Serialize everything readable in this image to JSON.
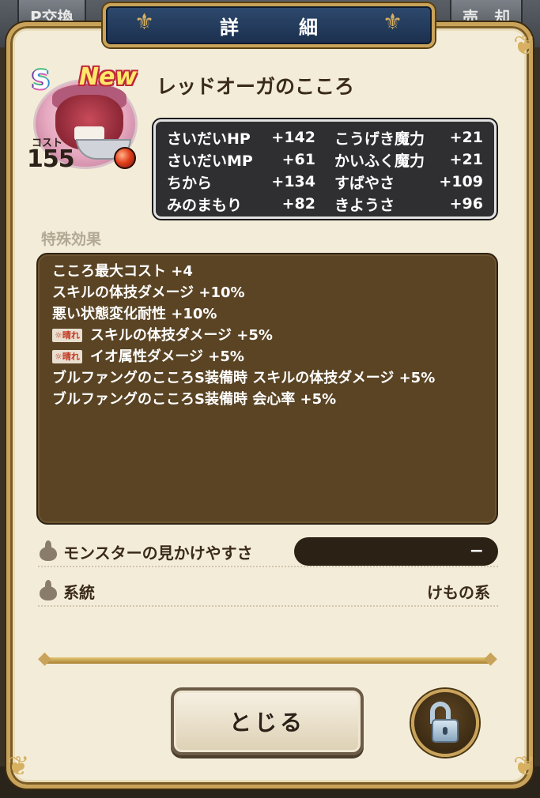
{
  "background": {
    "left_tab": "P交換",
    "right_tab": "売　却"
  },
  "dialog": {
    "title": "詳　細"
  },
  "monster": {
    "rank": "S",
    "new_badge": "New",
    "cost_label": "コスト",
    "cost_value": "155",
    "name": "レッドオーガのこころ"
  },
  "stats": [
    {
      "label": "さいだいHP",
      "value": "+142"
    },
    {
      "label": "こうげき魔力",
      "value": "+21"
    },
    {
      "label": "さいだいMP",
      "value": "+61"
    },
    {
      "label": "かいふく魔力",
      "value": "+21"
    },
    {
      "label": "ちから",
      "value": "+134"
    },
    {
      "label": "すばやさ",
      "value": "+109"
    },
    {
      "label": "みのまもり",
      "value": "+82"
    },
    {
      "label": "きようさ",
      "value": "+96"
    }
  ],
  "special": {
    "label": "特殊効果",
    "effects": [
      {
        "tag": "",
        "text": "こころ最大コスト +4"
      },
      {
        "tag": "",
        "text": "スキルの体技ダメージ +10%"
      },
      {
        "tag": "",
        "text": "悪い状態変化耐性 +10%"
      },
      {
        "tag": "☼晴れ",
        "text": "スキルの体技ダメージ +5%"
      },
      {
        "tag": "☼晴れ",
        "text": "イオ属性ダメージ +5%"
      },
      {
        "tag": "",
        "text": "ブルファングのこころS装備時 スキルの体技ダメージ +5%"
      },
      {
        "tag": "",
        "text": "ブルファングのこころS装備時 会心率 +5%"
      }
    ]
  },
  "info": {
    "visibility_label": "モンスターの見かけやすさ",
    "visibility_value": "−",
    "type_label": "系統",
    "type_value": "けもの系"
  },
  "buttons": {
    "close_label": "とじる"
  },
  "colors": {
    "panel_bg": "#f3ecd9",
    "gold_frame": "#c9a35a",
    "title_plate": "#1b2f4d",
    "stats_bg": "#2f2f31",
    "effects_bg": "#5a4424",
    "weather_tag": "#c2361f"
  }
}
